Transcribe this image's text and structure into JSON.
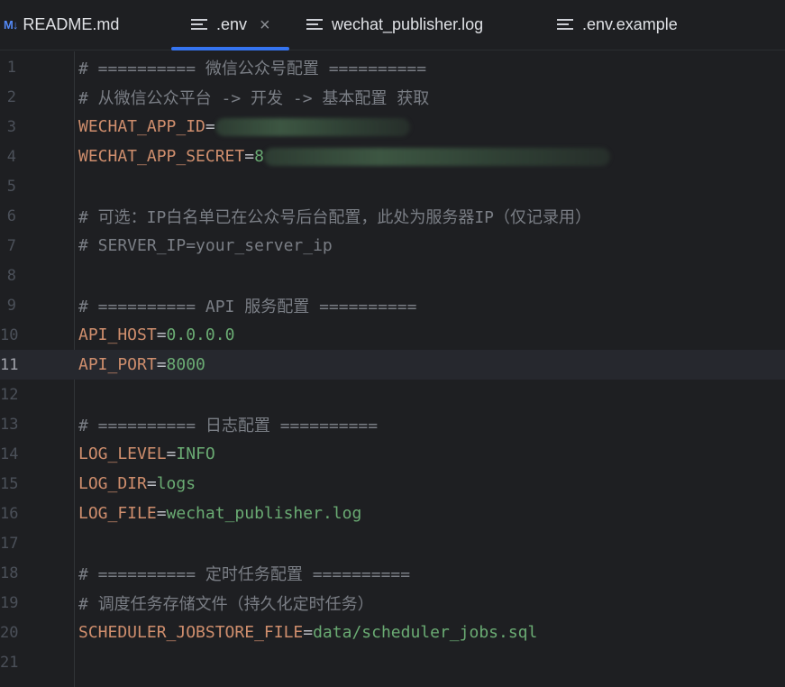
{
  "tabs": [
    {
      "icon": "markdown-icon",
      "icon_text": "M↓",
      "label": "README.md",
      "active": false
    },
    {
      "icon": "text-file-icon",
      "label": ".env",
      "active": true,
      "close": "×"
    },
    {
      "icon": "text-file-icon",
      "label": "wechat_publisher.log",
      "active": false
    },
    {
      "icon": "text-file-icon",
      "label": ".env.example",
      "active": false
    }
  ],
  "editor": {
    "current_line": 11,
    "lines": [
      {
        "n": "1",
        "type": "comment",
        "text": "# ========== 微信公众号配置 =========="
      },
      {
        "n": "2",
        "type": "comment",
        "text": "# 从微信公众平台 -> 开发 -> 基本配置 获取"
      },
      {
        "n": "3",
        "type": "kv",
        "key": "WECHAT_APP_ID",
        "eq": "=",
        "value": "",
        "redacted": true
      },
      {
        "n": "4",
        "type": "kv",
        "key": "WECHAT_APP_SECRET",
        "eq": "=",
        "value": "8",
        "redacted": true
      },
      {
        "n": "5",
        "type": "empty"
      },
      {
        "n": "6",
        "type": "comment",
        "text": "# 可选：IP白名单已在公众号后台配置，此处为服务器IP（仅记录用）"
      },
      {
        "n": "7",
        "type": "comment",
        "text": "# SERVER_IP=your_server_ip"
      },
      {
        "n": "8",
        "type": "empty"
      },
      {
        "n": "9",
        "type": "comment",
        "text": "# ========== API 服务配置 =========="
      },
      {
        "n": "10",
        "type": "kv",
        "key": "API_HOST",
        "eq": "=",
        "value": "0.0.0.0"
      },
      {
        "n": "11",
        "type": "kv",
        "key": "API_PORT",
        "eq": "=",
        "value": "8000"
      },
      {
        "n": "12",
        "type": "empty"
      },
      {
        "n": "13",
        "type": "comment",
        "text": "# ========== 日志配置 =========="
      },
      {
        "n": "14",
        "type": "kv",
        "key": "LOG_LEVEL",
        "eq": "=",
        "value": "INFO"
      },
      {
        "n": "15",
        "type": "kv",
        "key": "LOG_DIR",
        "eq": "=",
        "value": "logs"
      },
      {
        "n": "16",
        "type": "kv",
        "key": "LOG_FILE",
        "eq": "=",
        "value": "wechat_publisher.log"
      },
      {
        "n": "17",
        "type": "empty"
      },
      {
        "n": "18",
        "type": "comment",
        "text": "# ========== 定时任务配置 =========="
      },
      {
        "n": "19",
        "type": "comment",
        "text": "# 调度任务存储文件（持久化定时任务）"
      },
      {
        "n": "20",
        "type": "kv",
        "key": "SCHEDULER_JOBSTORE_FILE",
        "eq": "=",
        "value": "data/scheduler_jobs.sql"
      },
      {
        "n": "21",
        "type": "empty"
      }
    ]
  },
  "colors": {
    "background": "#1e1f22",
    "comment": "#7a7e85",
    "key": "#cf8e6d",
    "value": "#6aab73",
    "accent": "#3574f0"
  }
}
